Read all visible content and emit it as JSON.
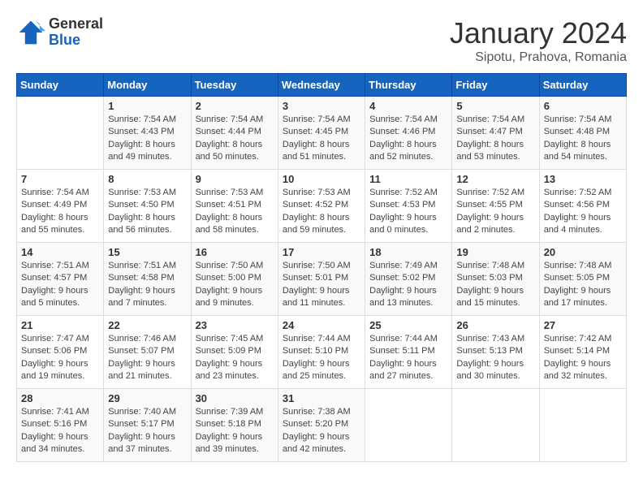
{
  "header": {
    "logo_general": "General",
    "logo_blue": "Blue",
    "title": "January 2024",
    "location": "Sipotu, Prahova, Romania"
  },
  "days_of_week": [
    "Sunday",
    "Monday",
    "Tuesday",
    "Wednesday",
    "Thursday",
    "Friday",
    "Saturday"
  ],
  "weeks": [
    [
      {
        "day": "",
        "info": ""
      },
      {
        "day": "1",
        "info": "Sunrise: 7:54 AM\nSunset: 4:43 PM\nDaylight: 8 hours\nand 49 minutes."
      },
      {
        "day": "2",
        "info": "Sunrise: 7:54 AM\nSunset: 4:44 PM\nDaylight: 8 hours\nand 50 minutes."
      },
      {
        "day": "3",
        "info": "Sunrise: 7:54 AM\nSunset: 4:45 PM\nDaylight: 8 hours\nand 51 minutes."
      },
      {
        "day": "4",
        "info": "Sunrise: 7:54 AM\nSunset: 4:46 PM\nDaylight: 8 hours\nand 52 minutes."
      },
      {
        "day": "5",
        "info": "Sunrise: 7:54 AM\nSunset: 4:47 PM\nDaylight: 8 hours\nand 53 minutes."
      },
      {
        "day": "6",
        "info": "Sunrise: 7:54 AM\nSunset: 4:48 PM\nDaylight: 8 hours\nand 54 minutes."
      }
    ],
    [
      {
        "day": "7",
        "info": "Sunrise: 7:54 AM\nSunset: 4:49 PM\nDaylight: 8 hours\nand 55 minutes."
      },
      {
        "day": "8",
        "info": "Sunrise: 7:53 AM\nSunset: 4:50 PM\nDaylight: 8 hours\nand 56 minutes."
      },
      {
        "day": "9",
        "info": "Sunrise: 7:53 AM\nSunset: 4:51 PM\nDaylight: 8 hours\nand 58 minutes."
      },
      {
        "day": "10",
        "info": "Sunrise: 7:53 AM\nSunset: 4:52 PM\nDaylight: 8 hours\nand 59 minutes."
      },
      {
        "day": "11",
        "info": "Sunrise: 7:52 AM\nSunset: 4:53 PM\nDaylight: 9 hours\nand 0 minutes."
      },
      {
        "day": "12",
        "info": "Sunrise: 7:52 AM\nSunset: 4:55 PM\nDaylight: 9 hours\nand 2 minutes."
      },
      {
        "day": "13",
        "info": "Sunrise: 7:52 AM\nSunset: 4:56 PM\nDaylight: 9 hours\nand 4 minutes."
      }
    ],
    [
      {
        "day": "14",
        "info": "Sunrise: 7:51 AM\nSunset: 4:57 PM\nDaylight: 9 hours\nand 5 minutes."
      },
      {
        "day": "15",
        "info": "Sunrise: 7:51 AM\nSunset: 4:58 PM\nDaylight: 9 hours\nand 7 minutes."
      },
      {
        "day": "16",
        "info": "Sunrise: 7:50 AM\nSunset: 5:00 PM\nDaylight: 9 hours\nand 9 minutes."
      },
      {
        "day": "17",
        "info": "Sunrise: 7:50 AM\nSunset: 5:01 PM\nDaylight: 9 hours\nand 11 minutes."
      },
      {
        "day": "18",
        "info": "Sunrise: 7:49 AM\nSunset: 5:02 PM\nDaylight: 9 hours\nand 13 minutes."
      },
      {
        "day": "19",
        "info": "Sunrise: 7:48 AM\nSunset: 5:03 PM\nDaylight: 9 hours\nand 15 minutes."
      },
      {
        "day": "20",
        "info": "Sunrise: 7:48 AM\nSunset: 5:05 PM\nDaylight: 9 hours\nand 17 minutes."
      }
    ],
    [
      {
        "day": "21",
        "info": "Sunrise: 7:47 AM\nSunset: 5:06 PM\nDaylight: 9 hours\nand 19 minutes."
      },
      {
        "day": "22",
        "info": "Sunrise: 7:46 AM\nSunset: 5:07 PM\nDaylight: 9 hours\nand 21 minutes."
      },
      {
        "day": "23",
        "info": "Sunrise: 7:45 AM\nSunset: 5:09 PM\nDaylight: 9 hours\nand 23 minutes."
      },
      {
        "day": "24",
        "info": "Sunrise: 7:44 AM\nSunset: 5:10 PM\nDaylight: 9 hours\nand 25 minutes."
      },
      {
        "day": "25",
        "info": "Sunrise: 7:44 AM\nSunset: 5:11 PM\nDaylight: 9 hours\nand 27 minutes."
      },
      {
        "day": "26",
        "info": "Sunrise: 7:43 AM\nSunset: 5:13 PM\nDaylight: 9 hours\nand 30 minutes."
      },
      {
        "day": "27",
        "info": "Sunrise: 7:42 AM\nSunset: 5:14 PM\nDaylight: 9 hours\nand 32 minutes."
      }
    ],
    [
      {
        "day": "28",
        "info": "Sunrise: 7:41 AM\nSunset: 5:16 PM\nDaylight: 9 hours\nand 34 minutes."
      },
      {
        "day": "29",
        "info": "Sunrise: 7:40 AM\nSunset: 5:17 PM\nDaylight: 9 hours\nand 37 minutes."
      },
      {
        "day": "30",
        "info": "Sunrise: 7:39 AM\nSunset: 5:18 PM\nDaylight: 9 hours\nand 39 minutes."
      },
      {
        "day": "31",
        "info": "Sunrise: 7:38 AM\nSunset: 5:20 PM\nDaylight: 9 hours\nand 42 minutes."
      },
      {
        "day": "",
        "info": ""
      },
      {
        "day": "",
        "info": ""
      },
      {
        "day": "",
        "info": ""
      }
    ]
  ]
}
